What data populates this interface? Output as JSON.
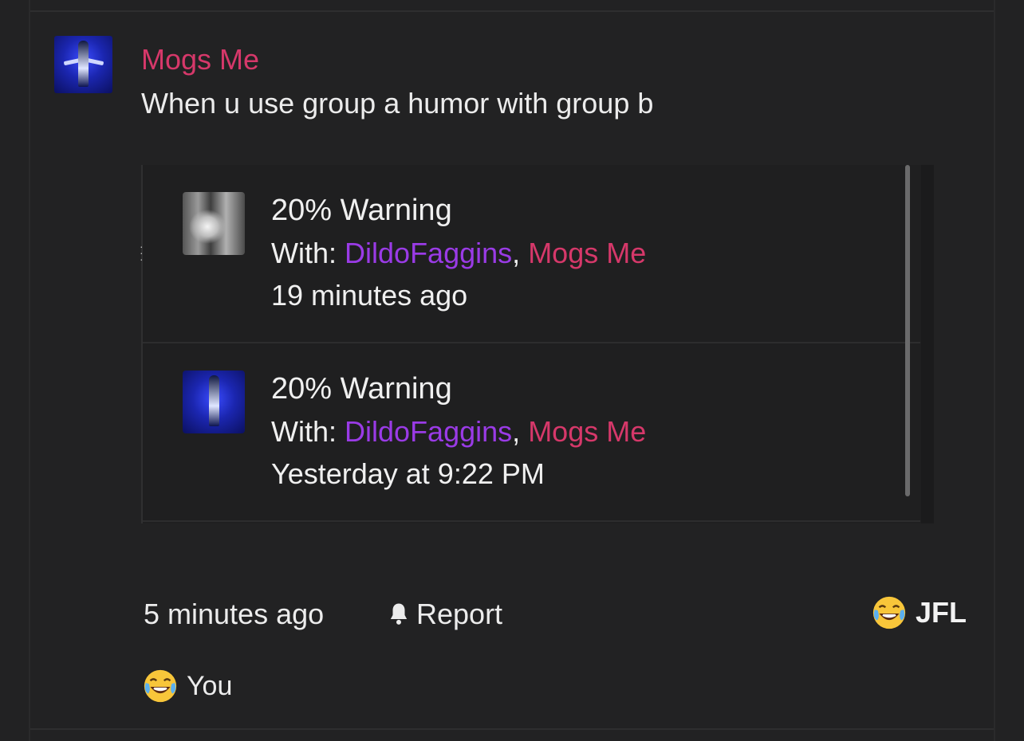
{
  "post": {
    "author": "Mogs Me",
    "message": "When u use group a humor with group b",
    "time": "5 minutes ago",
    "report_label": "Report"
  },
  "embed": {
    "conversations": [
      {
        "title": "20% Warning",
        "with_label": "With:",
        "participants": [
          "DildoFaggins",
          "Mogs Me"
        ],
        "separator": ",",
        "time": "19 minutes ago"
      },
      {
        "title": "20% Warning",
        "with_label": "With:",
        "participants": [
          "DildoFaggins",
          "Mogs Me"
        ],
        "separator": ",",
        "time": "Yesterday at 9:22 PM"
      }
    ]
  },
  "reactions": {
    "summary_label": "JFL",
    "summary_icon": "crying-laughing-emoji",
    "reacted_by": "You"
  },
  "colors": {
    "background": "#222223",
    "author_pink": "#d6386a",
    "participant_purple": "#9a3be6",
    "text": "#ececec"
  }
}
